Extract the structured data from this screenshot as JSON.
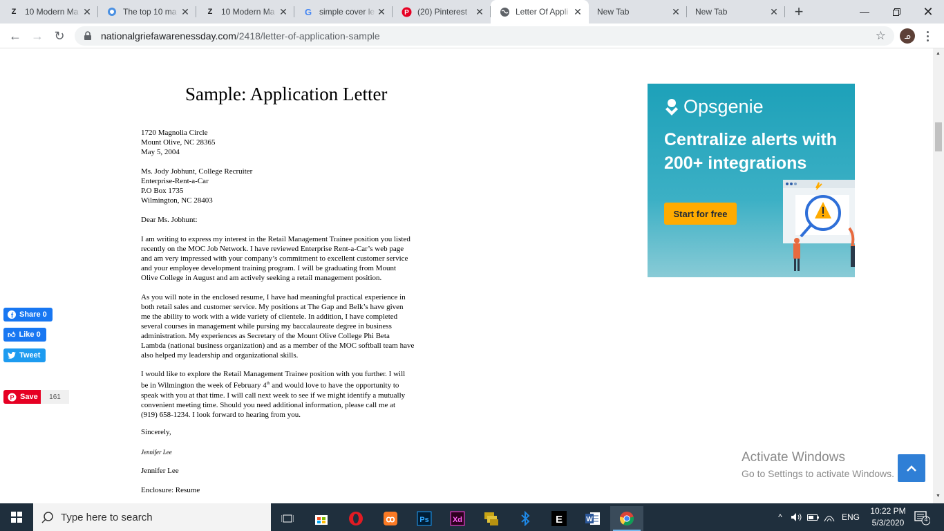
{
  "browser": {
    "tabs": [
      {
        "title": "10 Modern Ma",
        "favicon": "Z"
      },
      {
        "title": "The top 10 ma",
        "favicon": "circle-icon"
      },
      {
        "title": "10 Modern Ma",
        "favicon": "Z"
      },
      {
        "title": "simple cover le",
        "favicon": "G"
      },
      {
        "title": "(20) Pinterest",
        "favicon": "P"
      },
      {
        "title": "Letter Of Appli",
        "favicon": "globe-icon",
        "active": true
      },
      {
        "title": "New Tab",
        "favicon": ""
      },
      {
        "title": "New Tab",
        "favicon": ""
      }
    ],
    "url_domain": "nationalgriefawarenessday.com",
    "url_path": "/2418/letter-of-application-sample",
    "avatar_initial": "ᓄ"
  },
  "letter": {
    "title": "Sample: Application Letter",
    "sender_address": "1720 Magnolia Circle\nMount Olive, NC 28365\nMay 5, 2004",
    "recipient": "Ms. Jody Jobhunt, College Recruiter\nEnterprise-Rent-a-Car\nP.O Box 1735\nWilmington, NC 28403",
    "salutation": "Dear Ms. Jobhunt:",
    "para1": "I am writing to express my interest in the Retail Management Trainee position you listed\nrecently on the MOC Job Network.  I have reviewed Enterprise Rent-a-Car’s web page\nand am very impressed with your company’s commitment to excellent customer service\nand your employee development training program.  I will be graduating from Mount\nOlive College in August and am actively seeking a retail management position.",
    "para2": "As you will note in the enclosed resume, I have had meaningful practical experience in\nboth retail sales and customer service.  My positions at The Gap and Belk’s have given\nme the ability to work with a wide variety of clientele.  In addition, I have completed\nseveral courses in management while pursing my baccalaureate degree in business\nadministration. My experiences as Secretary of the Mount Olive College Phi Beta\nLambda (national business organization) and as a member of the MOC softball team have\nalso helped my leadership and organizational skills.",
    "para3_a": "I would like to explore the Retail Management Trainee position with you further.  I will\nbe in Wilmington the week of February 4",
    "para3_sup": "th",
    "para3_b": " and would love to have the opportunity to\nspeak with you at that time.  I will call next week to see if we might identify a mutually\nconvenient meeting time.  Should you need additional information, please call me at\n(919) 658-1234.  I look forward to hearing from you.",
    "closing": "Sincerely,",
    "signature": "Jennifer Lee",
    "name": "Jennifer Lee",
    "enclosure": "Enclosure:  Resume"
  },
  "social": {
    "share_label": "Share 0",
    "like_label": "Like 0",
    "tweet_label": "Tweet",
    "save_label": "Save",
    "save_count": "161"
  },
  "ad": {
    "brand": "Opsgenie",
    "headline": "Centralize alerts with 200+ integrations",
    "cta": "Start for free"
  },
  "watermark": {
    "line1": "Activate Windows",
    "line2": "Go to Settings to activate Windows."
  },
  "taskbar": {
    "search_placeholder": "Type here to search",
    "language": "ENG",
    "time": "10:22 PM",
    "date": "5/3/2020",
    "notification_count": "4"
  },
  "colors": {
    "ad_bg": "#1da1b9",
    "ad_cta": "#ffab00",
    "back_to_top": "#2f7fd6",
    "taskbar": "#1f2f3d"
  }
}
